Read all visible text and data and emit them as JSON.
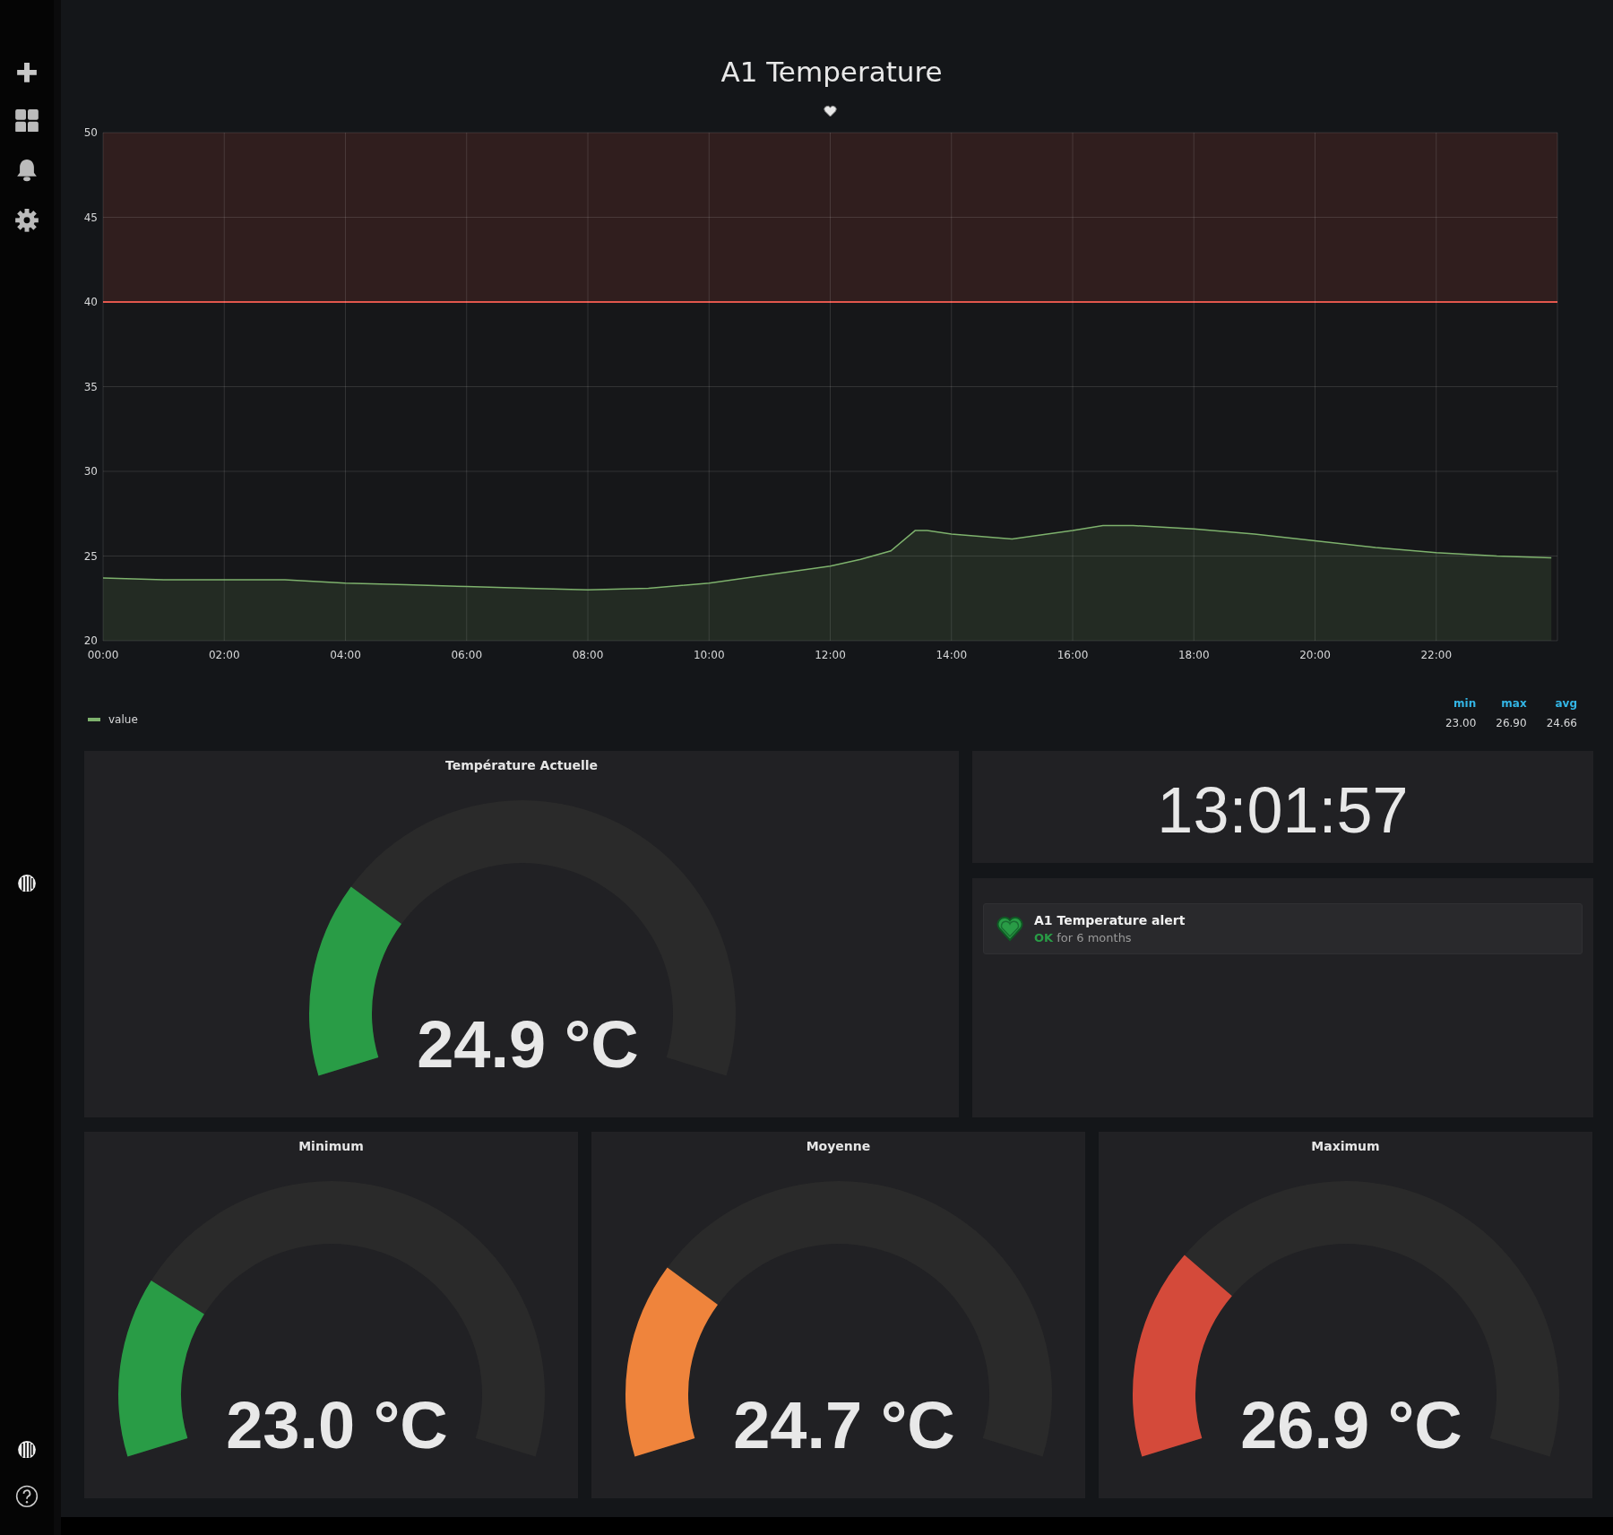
{
  "graph": {
    "title": "A1 Temperature",
    "chart_data": {
      "type": "area",
      "x": [
        0,
        1,
        2,
        3,
        4,
        5,
        6,
        7,
        8,
        9,
        10,
        11,
        12,
        12.5,
        13,
        13.4,
        13.6,
        14,
        15,
        16,
        16.5,
        17,
        18,
        19,
        20,
        21,
        22,
        23,
        23.9
      ],
      "series": [
        {
          "name": "value",
          "color": "#7eb26d",
          "values": [
            23.7,
            23.6,
            23.6,
            23.6,
            23.4,
            23.3,
            23.2,
            23.1,
            23.0,
            23.1,
            23.4,
            23.9,
            24.4,
            24.8,
            25.3,
            26.5,
            26.5,
            26.3,
            26.0,
            26.5,
            26.8,
            26.8,
            26.6,
            26.3,
            25.9,
            25.5,
            25.2,
            25.0,
            24.9
          ]
        }
      ],
      "xlim": [
        0,
        24
      ],
      "ylim": [
        20,
        50
      ],
      "xticks": [
        {
          "value": 0,
          "label": "00:00"
        },
        {
          "value": 2,
          "label": "02:00"
        },
        {
          "value": 4,
          "label": "04:00"
        },
        {
          "value": 6,
          "label": "06:00"
        },
        {
          "value": 8,
          "label": "08:00"
        },
        {
          "value": 10,
          "label": "10:00"
        },
        {
          "value": 12,
          "label": "12:00"
        },
        {
          "value": 14,
          "label": "14:00"
        },
        {
          "value": 16,
          "label": "16:00"
        },
        {
          "value": 18,
          "label": "18:00"
        },
        {
          "value": 20,
          "label": "20:00"
        },
        {
          "value": 22,
          "label": "22:00"
        }
      ],
      "yticks": [
        20,
        25,
        30,
        35,
        40,
        45,
        50
      ],
      "grid": true,
      "bands": [
        {
          "axis": "y",
          "from": 40,
          "to": 50,
          "color": "#e24d42"
        }
      ],
      "ref_lines": [
        {
          "axis": "y",
          "value": 40,
          "color": "#e24d42"
        }
      ]
    },
    "legend_stats": [
      {
        "label": "min",
        "value": "23.00"
      },
      {
        "label": "max",
        "value": "26.90"
      },
      {
        "label": "avg",
        "value": "24.66"
      }
    ]
  },
  "current": {
    "title": "Température Actuelle",
    "value": "24.9 °C",
    "level": 0.25,
    "color": "#299c46"
  },
  "clock": {
    "time": "13:01:57"
  },
  "alert": {
    "name": "A1 Temperature alert",
    "state": "OK",
    "duration": "for 6 months"
  },
  "gauges": [
    {
      "title": "Minimum",
      "value": "23.0 °C",
      "level": 0.23,
      "color": "#299c46"
    },
    {
      "title": "Moyenne",
      "value": "24.7 °C",
      "level": 0.25,
      "color": "#ef843c"
    },
    {
      "title": "Maximum",
      "value": "26.9 °C",
      "level": 0.27,
      "color": "#d44a3a"
    }
  ]
}
